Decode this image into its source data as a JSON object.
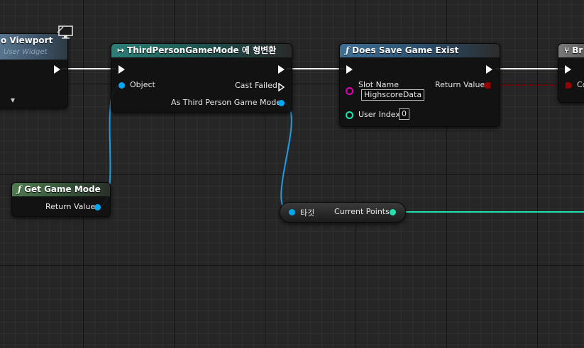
{
  "nodes": {
    "add_to_viewport": {
      "title": "o Viewport",
      "subtitle": "User Widget"
    },
    "cast_node": {
      "title": "ThirdPersonGameMode 에 형변환",
      "pin_object": "Object",
      "pin_cast_failed": "Cast Failed",
      "pin_as_mode": "As Third Person Game Mode"
    },
    "does_save_game_exist": {
      "title": "Does Save Game Exist",
      "pin_slot_name": "Slot Name",
      "slot_name_value": "HighscoreData",
      "pin_user_index": "User Index",
      "user_index_value": "0",
      "pin_return_value": "Return Value"
    },
    "branch": {
      "title": "Br",
      "pin_condition": "Co"
    },
    "get_game_mode": {
      "title": "Get Game Mode",
      "pin_return_value": "Return Value"
    },
    "get_variable": {
      "target_label": "타깃",
      "output_label": "Current Points"
    }
  },
  "colors": {
    "exec": "#ffffff",
    "object_pin": "#00a8f4",
    "string_pin": "#e000b4",
    "int_pin": "#1fe3af",
    "bool_pin": "#950000"
  },
  "icons": {
    "function_glyph": "ƒ",
    "cast_glyph": "↦",
    "expand_glyph": "▾"
  }
}
